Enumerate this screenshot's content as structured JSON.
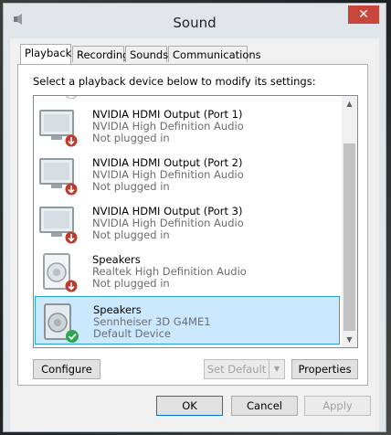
{
  "window": {
    "title": "Sound",
    "close_glyph": "✕"
  },
  "tabs": [
    {
      "label": "Playback",
      "active": true
    },
    {
      "label": "Recording",
      "active": false
    },
    {
      "label": "Sounds",
      "active": false
    },
    {
      "label": "Communications",
      "active": false
    }
  ],
  "instruction": "Select a playback device below to modify its settings:",
  "devices": [
    {
      "name": "NVIDIA HDMI Output (Port 1)",
      "driver": "NVIDIA High Definition Audio",
      "status": "Not plugged in",
      "icon": "monitor-icon",
      "badge": "unplugged-icon"
    },
    {
      "name": "NVIDIA HDMI Output (Port 2)",
      "driver": "NVIDIA High Definition Audio",
      "status": "Not plugged in",
      "icon": "monitor-icon",
      "badge": "unplugged-icon"
    },
    {
      "name": "NVIDIA HDMI Output (Port 3)",
      "driver": "NVIDIA High Definition Audio",
      "status": "Not plugged in",
      "icon": "monitor-icon",
      "badge": "unplugged-icon"
    },
    {
      "name": "Speakers",
      "driver": "Realtek High Definition Audio",
      "status": "Not plugged in",
      "icon": "speaker-icon",
      "badge": "unplugged-icon"
    },
    {
      "name": "Speakers",
      "driver": "Sennheiser 3D G4ME1",
      "status": "Default Device",
      "icon": "speaker-icon",
      "badge": "default-check-icon",
      "selected": true
    }
  ],
  "buttons": {
    "configure": "Configure",
    "set_default": "Set Default",
    "properties": "Properties",
    "ok": "OK",
    "cancel": "Cancel",
    "apply": "Apply"
  },
  "colors": {
    "selection": "#cce8ff",
    "selection_border": "#26a0da",
    "close": "#c9463d",
    "unplugged_badge": "#c0392b",
    "default_badge": "#2ea44f"
  }
}
